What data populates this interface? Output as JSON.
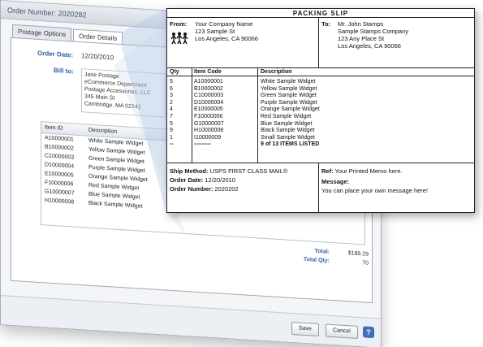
{
  "window": {
    "title": "Order Number: 2020282",
    "tabs": [
      "Postage Options",
      "Order Details"
    ],
    "order_date_label": "Order Date:",
    "order_date": "12/20/2010",
    "bill_to_label": "Bill to:",
    "bill_to_lines": [
      "Jane Postage",
      "eCommerce Department",
      "Postage Accessories, LLC",
      "345 Main St",
      "Cambridge, MA 02142"
    ],
    "items_header": {
      "id": "Item ID",
      "description": "Description"
    },
    "items": [
      {
        "id": "A10000001",
        "description": "White Sample Widget"
      },
      {
        "id": "B10000002",
        "description": "Yellow Sample Widget"
      },
      {
        "id": "C10000003",
        "description": "Green Sample Widget"
      },
      {
        "id": "D10000004",
        "description": "Purple Sample Widget"
      },
      {
        "id": "E10000005",
        "description": "Orange Sample Widget"
      },
      {
        "id": "F10000006",
        "description": "Red Sample Widget"
      },
      {
        "id": "G10000007",
        "description": "Blue Sample Widget"
      },
      {
        "id": "H10000008",
        "description": "Black Sample Widget"
      }
    ],
    "total_label": "Total:",
    "total_value": "$189.29",
    "total_qty_label": "Total Qty:",
    "total_qty_value": "70",
    "save_label": "Save",
    "cancel_label": "Cancel",
    "help_label": "?"
  },
  "slip": {
    "title": "PACKING SLIP",
    "from_label": "From:",
    "from_lines": [
      "Your Company Name",
      "123 Sample St",
      "Los Angeles, CA 90066"
    ],
    "to_label": "To:",
    "to_lines": [
      "Mr. John Stamps",
      "Sample Stamps Company",
      "123 Any Place St",
      "Los Angeles, CA 90066"
    ],
    "columns": {
      "qty": "Qty",
      "code": "Item Code",
      "desc": "Description"
    },
    "items": [
      {
        "qty": "5",
        "code": "A10000001",
        "desc": "White Sample Widget"
      },
      {
        "qty": "6",
        "code": "B10000002",
        "desc": "Yellow Sample Widget"
      },
      {
        "qty": "3",
        "code": "C10000003",
        "desc": "Green Sample Widget"
      },
      {
        "qty": "2",
        "code": "D10000004",
        "desc": "Purple Sample Widget"
      },
      {
        "qty": "4",
        "code": "E10000005",
        "desc": "Orange Sample Widget"
      },
      {
        "qty": "7",
        "code": "F10000006",
        "desc": "Red Sample Widget"
      },
      {
        "qty": "5",
        "code": "G10000007",
        "desc": "Blue Sample Widget"
      },
      {
        "qty": "9",
        "code": "H10000008",
        "desc": "Black Sample Widget"
      },
      {
        "qty": "1",
        "code": "I10000009",
        "desc": "Small Sample Widget"
      },
      {
        "qty": "--",
        "code": "---------",
        "desc": "9 of 13 ITEMS LISTED"
      }
    ],
    "ship_method_label": "Ship Method:",
    "ship_method": "USPS FIRST CLASS MAIL®",
    "order_date_label": "Order Date:",
    "order_date": "12/20/2010",
    "order_number_label": "Order Number:",
    "order_number": "2020202",
    "ref_label": "Ref:",
    "ref_value": "Your Printed Memo here.",
    "message_label": "Message:",
    "message_value": "You can place your own message here!"
  },
  "colors": {
    "accent": "#2e5f9c",
    "help_button": "#3e6fb8"
  }
}
